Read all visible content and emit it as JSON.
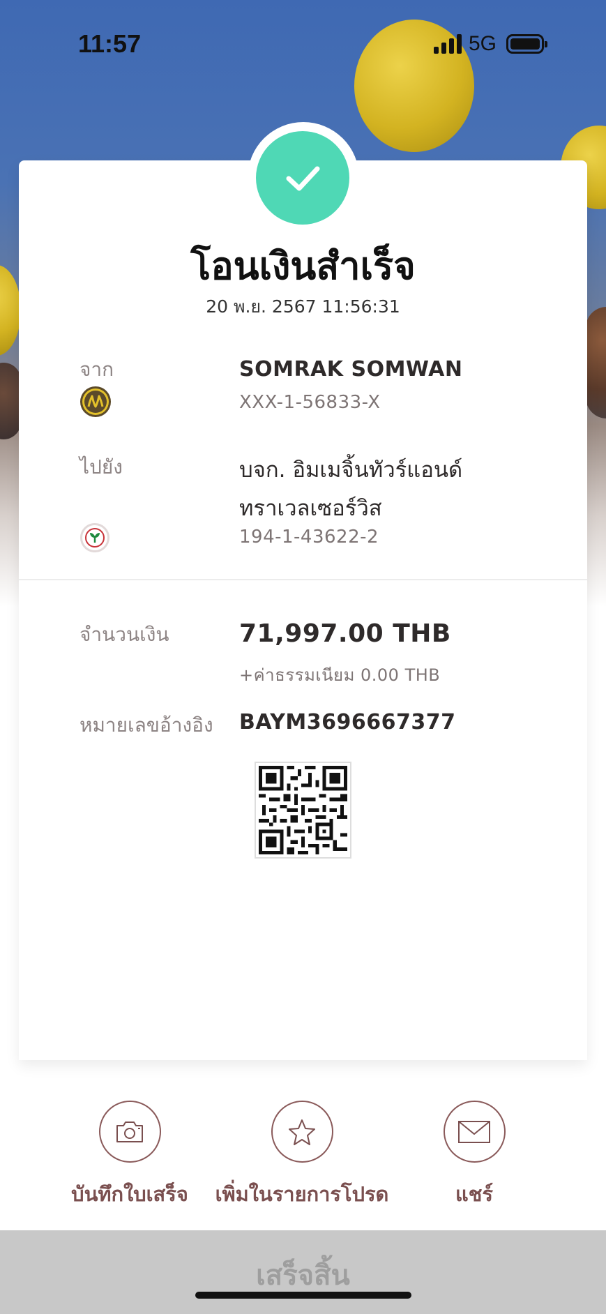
{
  "status_bar": {
    "time": "11:57",
    "network": "5G"
  },
  "receipt": {
    "title": "โอนเงินสำเร็จ",
    "datetime": "20 พ.ย. 2567 11:56:31",
    "from": {
      "label": "จาก",
      "name": "SOMRAK SOMWAN",
      "account": "XXX-1-56833-X",
      "bank_icon": "krungsri-logo"
    },
    "to": {
      "label": "ไปยัง",
      "name_line1": "บจก. อิมเมจิ้นทัวร์แอนด์",
      "name_line2": "ทราเวลเซอร์วิส",
      "account": "194-1-43622-2",
      "bank_icon": "kbank-logo"
    },
    "amount": {
      "label": "จำนวนเงิน",
      "value": "71,997.00 THB",
      "fee": "+ค่าธรรมเนียม 0.00 THB"
    },
    "reference": {
      "label": "หมายเลขอ้างอิง",
      "value": "BAYM3696667377"
    }
  },
  "actions": [
    {
      "label": "บันทึกใบเสร็จ",
      "icon": "camera-icon"
    },
    {
      "label": "เพิ่มในรายการโปรด",
      "icon": "star-icon"
    },
    {
      "label": "แชร์",
      "icon": "mail-icon"
    }
  ],
  "done_button": {
    "label": "เสร็จสิ้น"
  },
  "colors": {
    "success": "#4fd8b5",
    "action_accent": "#7a4f4f",
    "label_gray": "#8d8484",
    "done_bar": "#c8c8c8"
  }
}
